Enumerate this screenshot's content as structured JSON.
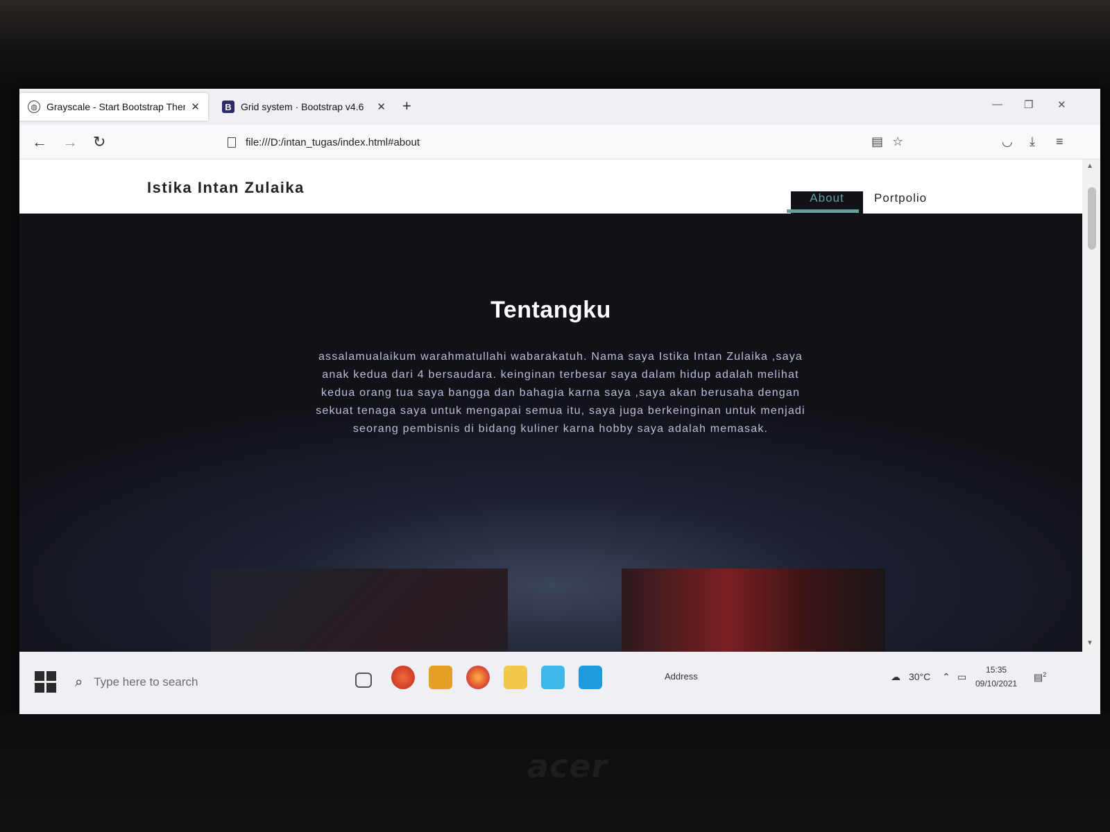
{
  "browser": {
    "tabs": [
      {
        "title": "Grayscale - Start Bootstrap Theme",
        "icon": "globe-icon",
        "active": true
      },
      {
        "title": "Grid system · Bootstrap v4.6",
        "icon": "bootstrap-icon",
        "active": false
      }
    ],
    "url": "file:///D:/intan_tugas/index.html#about"
  },
  "site": {
    "brand": "Istika Intan Zulaika",
    "nav": {
      "about": "About",
      "portfolio": "Portpolio"
    },
    "about": {
      "heading": "Tentangku",
      "text": "assalamualaikum warahmatullahi wabarakatuh. Nama saya Istika Intan Zulaika ,saya anak kedua dari 4 bersaudara. keinginan terbesar saya dalam hidup adalah melihat kedua orang tua saya bangga dan bahagia karna saya ,saya akan berusaha dengan sekuat tenaga saya untuk mengapai semua itu, saya juga berkeinginan untuk menjadi seorang pembisnis di bidang kuliner karna hobby saya adalah memasak."
    },
    "colors": {
      "accent": "#64a19d",
      "background": "#111117"
    }
  },
  "taskbar": {
    "search_placeholder": "Type here to search",
    "address_label": "Address",
    "temperature": "30°C",
    "time": "15:35",
    "date": "09/10/2021",
    "notification_count": "2"
  },
  "laptop_brand": "acer"
}
